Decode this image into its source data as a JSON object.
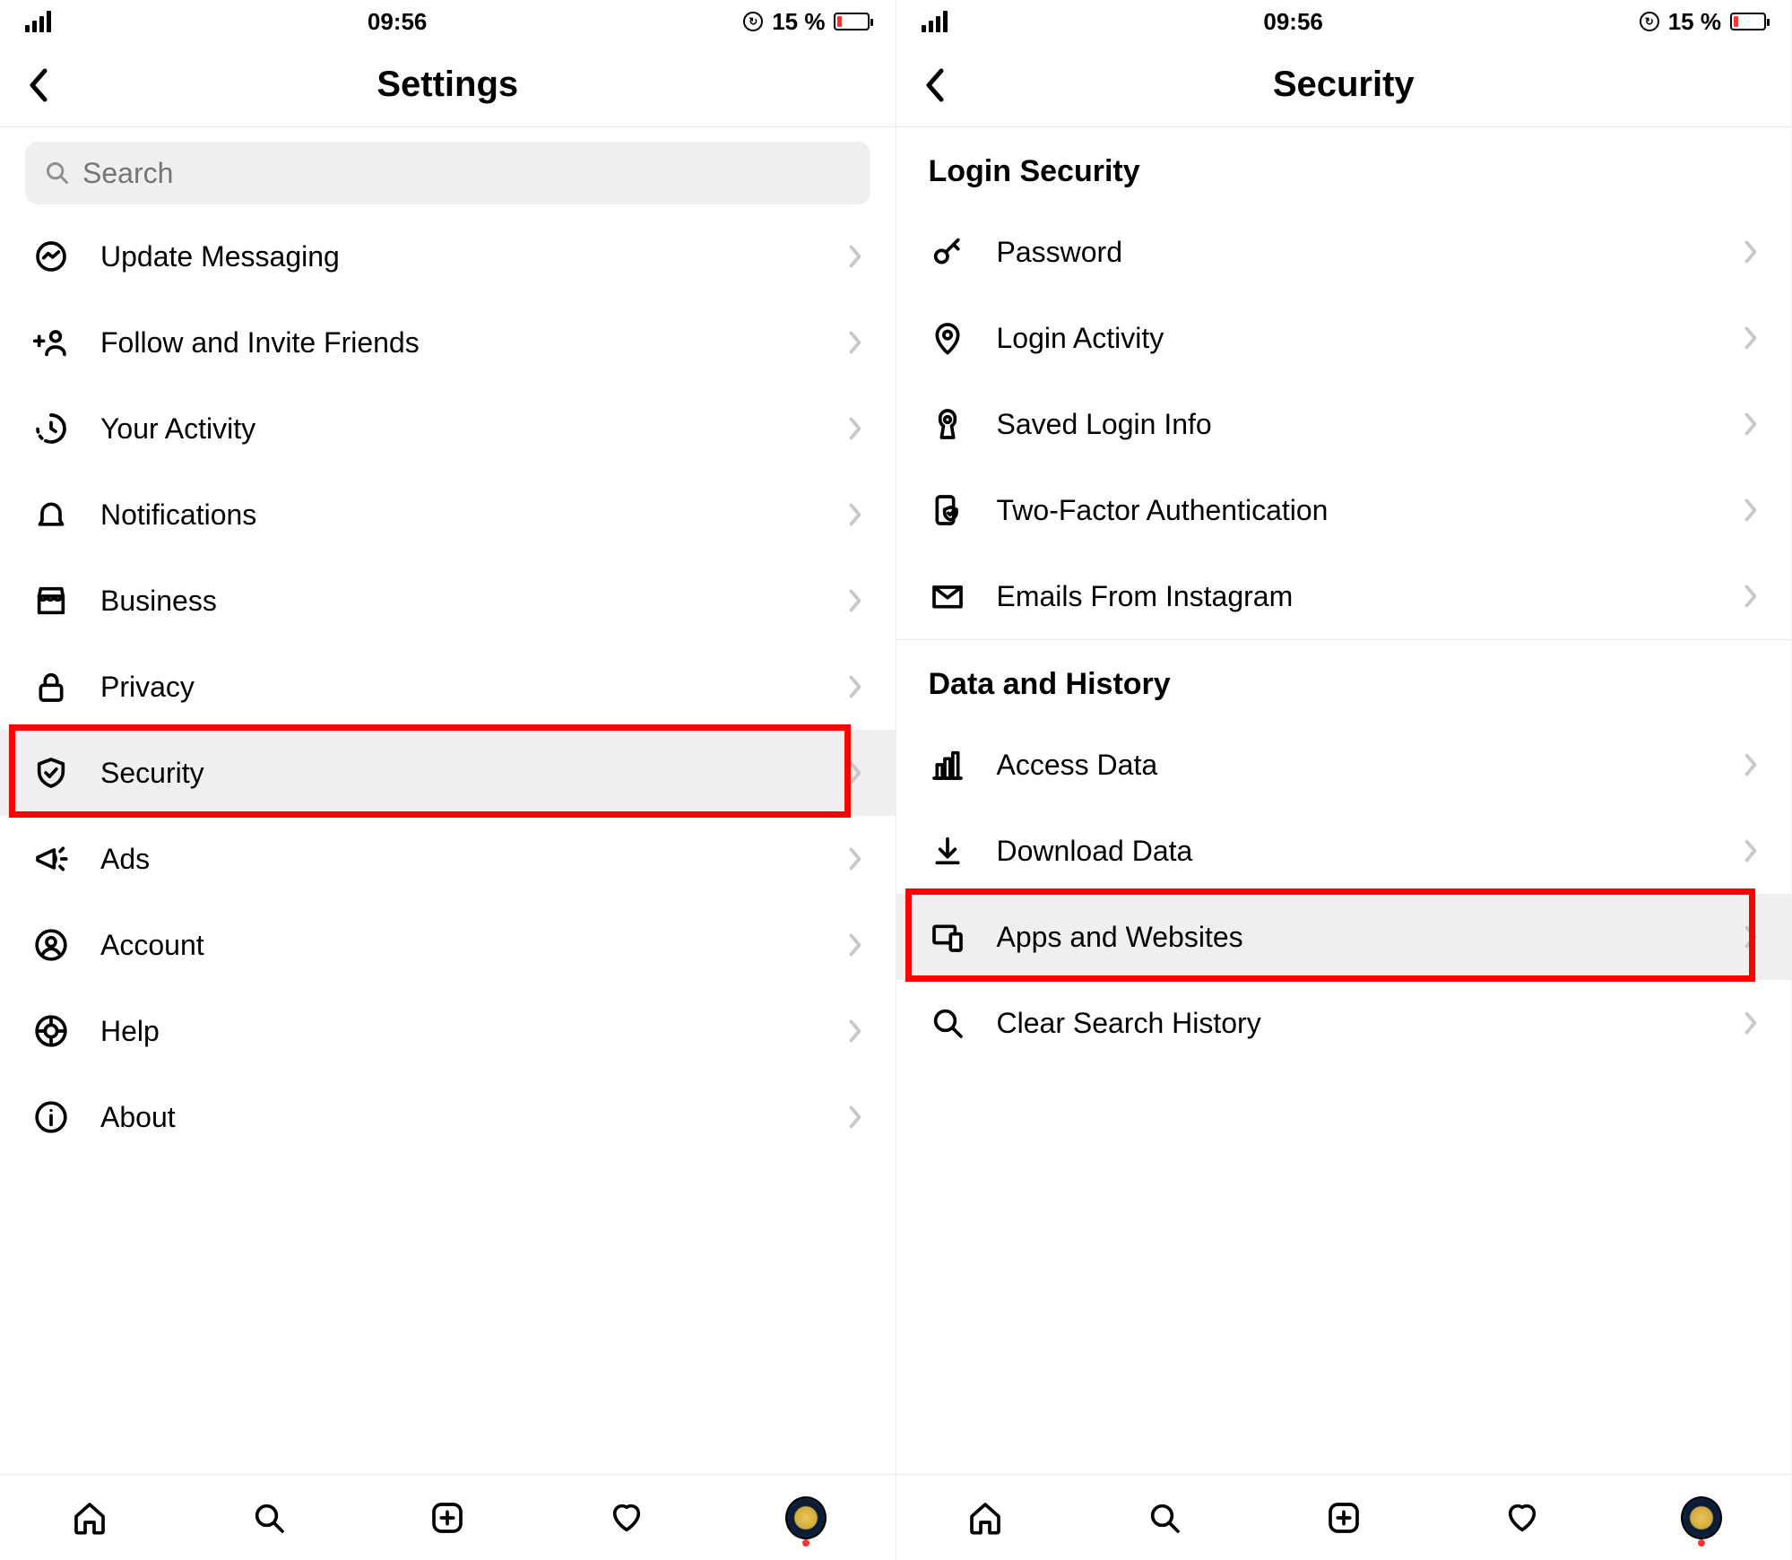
{
  "status": {
    "time": "09:56",
    "battery_text": "15 %"
  },
  "left": {
    "title": "Settings",
    "search_placeholder": "Search",
    "items": [
      {
        "label": "Update Messaging",
        "icon": "messenger-icon",
        "highlighted": false
      },
      {
        "label": "Follow and Invite Friends",
        "icon": "add-friend-icon",
        "highlighted": false
      },
      {
        "label": "Your Activity",
        "icon": "activity-clock-icon",
        "highlighted": false
      },
      {
        "label": "Notifications",
        "icon": "bell-icon",
        "highlighted": false
      },
      {
        "label": "Business",
        "icon": "storefront-icon",
        "highlighted": false
      },
      {
        "label": "Privacy",
        "icon": "lock-icon",
        "highlighted": false
      },
      {
        "label": "Security",
        "icon": "shield-check-icon",
        "highlighted": true
      },
      {
        "label": "Ads",
        "icon": "megaphone-icon",
        "highlighted": false
      },
      {
        "label": "Account",
        "icon": "person-circle-icon",
        "highlighted": false
      },
      {
        "label": "Help",
        "icon": "lifebuoy-icon",
        "highlighted": false
      },
      {
        "label": "About",
        "icon": "info-icon",
        "highlighted": false
      }
    ]
  },
  "right": {
    "title": "Security",
    "sections": [
      {
        "title": "Login Security",
        "items": [
          {
            "label": "Password",
            "icon": "key-icon",
            "highlighted": false
          },
          {
            "label": "Login Activity",
            "icon": "location-pin-icon",
            "highlighted": false
          },
          {
            "label": "Saved Login Info",
            "icon": "keyhole-icon",
            "highlighted": false
          },
          {
            "label": "Two-Factor Authentication",
            "icon": "phone-shield-icon",
            "highlighted": false
          },
          {
            "label": "Emails From Instagram",
            "icon": "envelope-icon",
            "highlighted": false
          }
        ]
      },
      {
        "title": "Data and History",
        "items": [
          {
            "label": "Access Data",
            "icon": "bar-chart-icon",
            "highlighted": false
          },
          {
            "label": "Download Data",
            "icon": "download-icon",
            "highlighted": false
          },
          {
            "label": "Apps and Websites",
            "icon": "devices-icon",
            "highlighted": true
          },
          {
            "label": "Clear Search History",
            "icon": "magnifier-icon",
            "highlighted": false
          }
        ]
      }
    ]
  },
  "tabs": [
    {
      "name": "tab-home",
      "icon": "home-icon"
    },
    {
      "name": "tab-search",
      "icon": "magnifier-icon"
    },
    {
      "name": "tab-new",
      "icon": "plus-square-icon"
    },
    {
      "name": "tab-activity",
      "icon": "heart-icon"
    },
    {
      "name": "tab-profile",
      "icon": "avatar"
    }
  ]
}
